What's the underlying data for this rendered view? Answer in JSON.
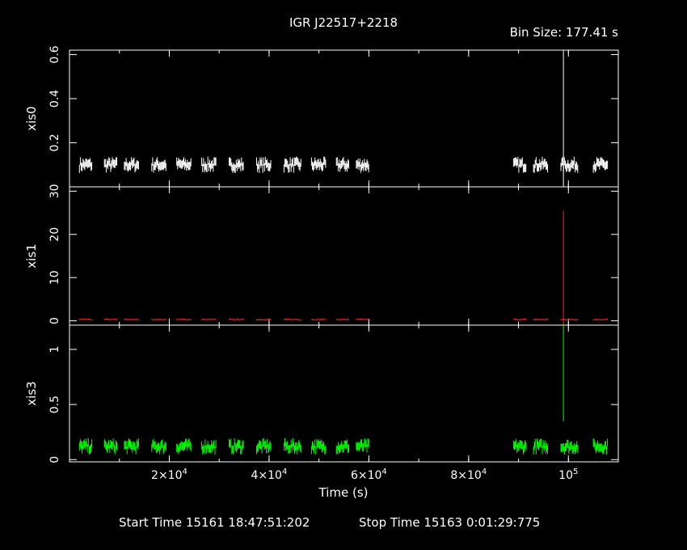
{
  "header": {
    "title": "IGR J22517+2218",
    "bin_size": "Bin Size: 177.41 s"
  },
  "footer": {
    "start_time": "Start Time 15161 18:47:51:202",
    "stop_time": "Stop Time 15163  0:01:29:775"
  },
  "colors": {
    "xis0": "#ffffff",
    "xis1": "#ff2020",
    "xis3": "#00ff00",
    "background": "#000000"
  },
  "chart_data": {
    "type": "line",
    "title": "IGR J22517+2218",
    "xlabel": "Time (s)",
    "xlim": [
      0,
      110000
    ],
    "x_ticks": [
      {
        "value": 20000,
        "label": "2×10",
        "exp": "4"
      },
      {
        "value": 40000,
        "label": "4×10",
        "exp": "4"
      },
      {
        "value": 60000,
        "label": "6×10",
        "exp": "4"
      },
      {
        "value": 80000,
        "label": "8×10",
        "exp": "4"
      },
      {
        "value": 100000,
        "label": "10",
        "exp": "5"
      }
    ],
    "panels": [
      {
        "name": "xis0",
        "ylabel": "xis0",
        "ylim": [
          0,
          0.62
        ],
        "y_ticks": [
          {
            "value": 0.2,
            "label": "0.2"
          },
          {
            "value": 0.4,
            "label": "0.4"
          },
          {
            "value": 0.6,
            "label": "0.6"
          }
        ],
        "baseline": 0.1,
        "spike": {
          "x": 99000,
          "y": 0.62
        },
        "segments": [
          [
            2000,
            4500
          ],
          [
            7000,
            9500
          ],
          [
            11000,
            14000
          ],
          [
            16500,
            19500
          ],
          [
            21500,
            24500
          ],
          [
            26500,
            29500
          ],
          [
            32000,
            35000
          ],
          [
            37500,
            40500
          ],
          [
            43000,
            46500
          ],
          [
            48500,
            51500
          ],
          [
            53500,
            56000
          ],
          [
            57500,
            60000
          ],
          [
            89000,
            91500
          ],
          [
            93000,
            96000
          ],
          [
            98500,
            102000
          ],
          [
            105000,
            108000
          ]
        ]
      },
      {
        "name": "xis1",
        "ylabel": "xis1",
        "ylim": [
          -1,
          31
        ],
        "y_ticks": [
          {
            "value": 0,
            "label": "0"
          },
          {
            "value": 10,
            "label": "10"
          },
          {
            "value": 20,
            "label": "20"
          },
          {
            "value": 30,
            "label": "30"
          }
        ],
        "baseline": 0.3,
        "spike": {
          "x": 99000,
          "y": 25.5
        },
        "segments": [
          [
            2000,
            4500
          ],
          [
            7000,
            9500
          ],
          [
            11000,
            14000
          ],
          [
            16500,
            19500
          ],
          [
            21500,
            24500
          ],
          [
            26500,
            29500
          ],
          [
            32000,
            35000
          ],
          [
            37500,
            40500
          ],
          [
            43000,
            46500
          ],
          [
            48500,
            51500
          ],
          [
            53500,
            56000
          ],
          [
            57500,
            60000
          ],
          [
            89000,
            91500
          ],
          [
            93000,
            96000
          ],
          [
            98500,
            102000
          ],
          [
            105000,
            108000
          ]
        ]
      },
      {
        "name": "xis3",
        "ylabel": "xis3",
        "ylim": [
          -0.02,
          1.22
        ],
        "y_ticks": [
          {
            "value": 0,
            "label": "0"
          },
          {
            "value": 0.5,
            "label": "0.5"
          },
          {
            "value": 1,
            "label": "1"
          }
        ],
        "baseline": 0.12,
        "spike": {
          "x": 99000,
          "y": 1.22,
          "low": 0.35
        },
        "segments": [
          [
            2000,
            4500
          ],
          [
            7000,
            9500
          ],
          [
            11000,
            14000
          ],
          [
            16500,
            19500
          ],
          [
            21500,
            24500
          ],
          [
            26500,
            29500
          ],
          [
            32000,
            35000
          ],
          [
            37500,
            40500
          ],
          [
            43000,
            46500
          ],
          [
            48500,
            51500
          ],
          [
            53500,
            56000
          ],
          [
            57500,
            60000
          ],
          [
            89000,
            91500
          ],
          [
            93000,
            96000
          ],
          [
            98500,
            102000
          ],
          [
            105000,
            108000
          ]
        ]
      }
    ]
  }
}
